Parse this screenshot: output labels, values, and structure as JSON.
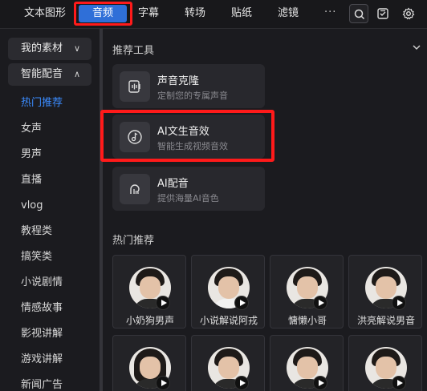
{
  "nav": {
    "tabs": [
      {
        "label": "文本图形"
      },
      {
        "label": "音频"
      },
      {
        "label": "字幕"
      },
      {
        "label": "转场"
      },
      {
        "label": "贴纸"
      },
      {
        "label": "滤镜"
      }
    ],
    "more_label": "···",
    "active_index": 1,
    "icons": [
      "search-icon",
      "checklist-icon",
      "gear-icon"
    ],
    "accent_color": "#2f6fd8",
    "highlight_color": "#ff1a1a"
  },
  "sidebar": {
    "group1": {
      "label": "我的素材",
      "chevron": "chevron-down-icon"
    },
    "group2": {
      "label": "智能配音",
      "chevron": "chevron-up-icon"
    },
    "items": [
      {
        "label": "热门推荐",
        "active": true
      },
      {
        "label": "女声"
      },
      {
        "label": "男声"
      },
      {
        "label": "直播"
      },
      {
        "label": "vlog"
      },
      {
        "label": "教程类"
      },
      {
        "label": "搞笑类"
      },
      {
        "label": "小说剧情"
      },
      {
        "label": "情感故事"
      },
      {
        "label": "影视讲解"
      },
      {
        "label": "游戏讲解"
      },
      {
        "label": "新闻广告"
      }
    ]
  },
  "tools": {
    "title": "推荐工具",
    "cards": [
      {
        "title": "声音克隆",
        "subtitle": "定制您的专属声音",
        "icon": "voice-clone-icon"
      },
      {
        "title": "AI文生音效",
        "subtitle": "智能生成视频音效",
        "icon": "music-note-icon"
      },
      {
        "title": "AI配音",
        "subtitle": "提供海量AI音色",
        "icon": "ai-voice-icon"
      }
    ]
  },
  "hot": {
    "title": "热门推荐",
    "voices": [
      {
        "name": "小奶狗男声"
      },
      {
        "name": "小说解说阿戎"
      },
      {
        "name": "慵懒小哥"
      },
      {
        "name": "洪亮解说男音"
      },
      {
        "name": ""
      },
      {
        "name": ""
      },
      {
        "name": ""
      },
      {
        "name": ""
      }
    ]
  }
}
